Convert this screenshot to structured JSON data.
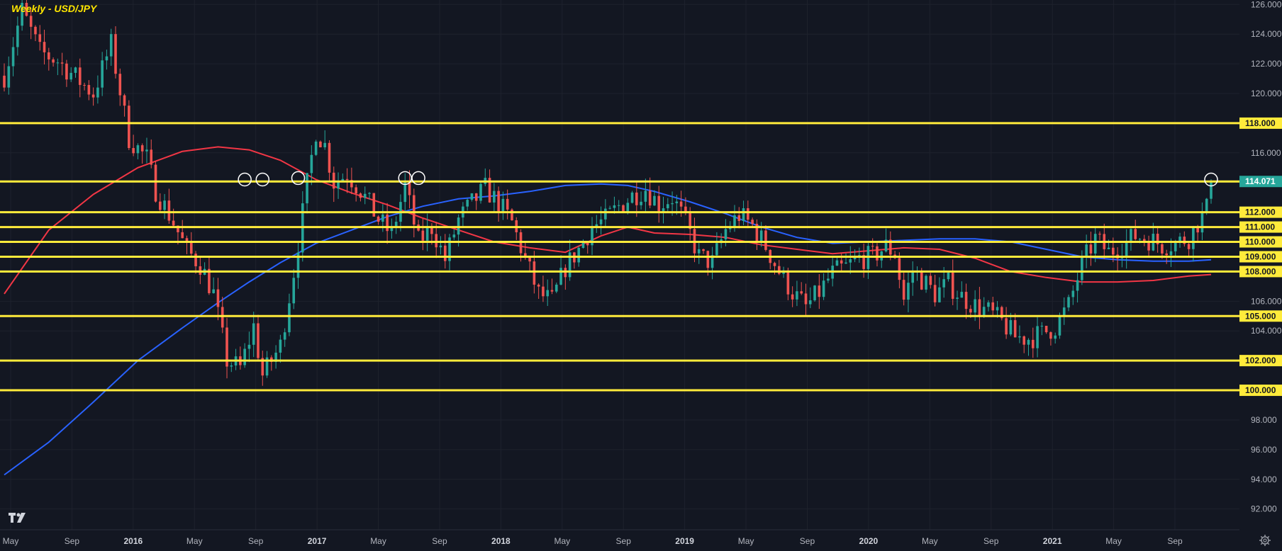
{
  "chart_data": {
    "type": "candlestick",
    "title": "Weekly - USD/JPY",
    "ylim": [
      90.6,
      126.3
    ],
    "y_ticks": [
      "126.000",
      "124.000",
      "122.000",
      "120.000",
      "118.000",
      "116.000",
      "114.000",
      "112.000",
      "110.000",
      "108.000",
      "106.000",
      "104.000",
      "102.000",
      "100.000",
      "98.000",
      "96.000",
      "94.000",
      "92.000"
    ],
    "x_labels": [
      {
        "label": "May",
        "bold": false
      },
      {
        "label": "Sep",
        "bold": false
      },
      {
        "label": "2016",
        "bold": true
      },
      {
        "label": "May",
        "bold": false
      },
      {
        "label": "Sep",
        "bold": false
      },
      {
        "label": "2017",
        "bold": true
      },
      {
        "label": "May",
        "bold": false
      },
      {
        "label": "Sep",
        "bold": false
      },
      {
        "label": "2018",
        "bold": true
      },
      {
        "label": "May",
        "bold": false
      },
      {
        "label": "Sep",
        "bold": false
      },
      {
        "label": "2019",
        "bold": true
      },
      {
        "label": "May",
        "bold": false
      },
      {
        "label": "Sep",
        "bold": false
      },
      {
        "label": "2020",
        "bold": true
      },
      {
        "label": "May",
        "bold": false
      },
      {
        "label": "Sep",
        "bold": false
      },
      {
        "label": "2021",
        "bold": true
      },
      {
        "label": "May",
        "bold": false
      },
      {
        "label": "Sep",
        "bold": false
      }
    ],
    "horizontal_levels": [
      {
        "value": 118.0,
        "label": "118.000"
      },
      {
        "value": 114.071,
        "label": "114.071"
      },
      {
        "value": 112.0,
        "label": "112.000"
      },
      {
        "value": 111.0,
        "label": "111.000"
      },
      {
        "value": 110.0,
        "label": "110.000"
      },
      {
        "value": 109.0,
        "label": "109.000"
      },
      {
        "value": 108.0,
        "label": "108.000"
      },
      {
        "value": 105.0,
        "label": "105.000"
      },
      {
        "value": 102.0,
        "label": "102.000"
      },
      {
        "value": 100.0,
        "label": "100.000"
      }
    ],
    "last_price": {
      "value": 114.071,
      "label": "114.071"
    },
    "price_path": [
      [
        0,
        121.2
      ],
      [
        4,
        125.6
      ],
      [
        8,
        122.8
      ],
      [
        12,
        122.2
      ],
      [
        16,
        121.1
      ],
      [
        20,
        120.0
      ],
      [
        24,
        123.3
      ],
      [
        28,
        117.0
      ],
      [
        32,
        115.6
      ],
      [
        34,
        113.5
      ],
      [
        38,
        111.3
      ],
      [
        41,
        109.4
      ],
      [
        44,
        108.5
      ],
      [
        47,
        106.5
      ],
      [
        50,
        102.0
      ],
      [
        53,
        101.5
      ],
      [
        56,
        104.3
      ],
      [
        58,
        101.0
      ],
      [
        62,
        103.0
      ],
      [
        65,
        108.0
      ],
      [
        68,
        113.9
      ],
      [
        70,
        117.5
      ],
      [
        72,
        116.5
      ],
      [
        74,
        114.0
      ],
      [
        77,
        114.6
      ],
      [
        80,
        113.5
      ],
      [
        84,
        111.5
      ],
      [
        87,
        110.5
      ],
      [
        90,
        113.8
      ],
      [
        93,
        110.0
      ],
      [
        96,
        111.0
      ],
      [
        99,
        108.8
      ],
      [
        102,
        111.5
      ],
      [
        105,
        112.6
      ],
      [
        108,
        113.6
      ],
      [
        111,
        112.6
      ],
      [
        114,
        111.3
      ],
      [
        117,
        108.8
      ],
      [
        120,
        106.5
      ],
      [
        123,
        106.0
      ],
      [
        126,
        108.3
      ],
      [
        129,
        109.5
      ],
      [
        132,
        111.0
      ],
      [
        135,
        111.5
      ],
      [
        138,
        112.4
      ],
      [
        141,
        113.1
      ],
      [
        144,
        113.6
      ],
      [
        147,
        112.5
      ],
      [
        150,
        113.0
      ],
      [
        153,
        111.3
      ],
      [
        156,
        109.0
      ],
      [
        159,
        108.6
      ],
      [
        162,
        110.8
      ],
      [
        165,
        111.8
      ],
      [
        168,
        111.1
      ],
      [
        171,
        109.7
      ],
      [
        174,
        108.0
      ],
      [
        177,
        106.6
      ],
      [
        180,
        105.6
      ],
      [
        183,
        106.6
      ],
      [
        186,
        107.9
      ],
      [
        189,
        108.3
      ],
      [
        192,
        108.9
      ],
      [
        195,
        109.0
      ],
      [
        198,
        109.7
      ],
      [
        200,
        109.2
      ],
      [
        202,
        106.1
      ],
      [
        204,
        108.0
      ],
      [
        206,
        107.5
      ],
      [
        209,
        106.5
      ],
      [
        212,
        107.2
      ],
      [
        215,
        106.3
      ],
      [
        218,
        105.7
      ],
      [
        221,
        105.3
      ],
      [
        224,
        104.6
      ],
      [
        227,
        103.6
      ],
      [
        230,
        103.5
      ],
      [
        233,
        103.8
      ],
      [
        236,
        104.3
      ],
      [
        239,
        105.7
      ],
      [
        242,
        108.5
      ],
      [
        245,
        110.2
      ],
      [
        248,
        109.3
      ],
      [
        251,
        109.8
      ],
      [
        254,
        110.4
      ],
      [
        257,
        110.2
      ],
      [
        260,
        109.8
      ],
      [
        263,
        109.9
      ],
      [
        266,
        110.3
      ],
      [
        268,
        111.3
      ],
      [
        270,
        112.2
      ],
      [
        271,
        114.071
      ]
    ],
    "sma_red": [
      [
        0,
        106.5
      ],
      [
        10,
        110.8
      ],
      [
        20,
        113.2
      ],
      [
        30,
        115.0
      ],
      [
        40,
        116.1
      ],
      [
        48,
        116.4
      ],
      [
        55,
        116.2
      ],
      [
        62,
        115.5
      ],
      [
        70,
        114.2
      ],
      [
        78,
        113.3
      ],
      [
        86,
        112.5
      ],
      [
        94,
        111.6
      ],
      [
        102,
        110.8
      ],
      [
        110,
        110.0
      ],
      [
        118,
        109.6
      ],
      [
        126,
        109.3
      ],
      [
        134,
        110.4
      ],
      [
        140,
        111.0
      ],
      [
        146,
        110.6
      ],
      [
        154,
        110.5
      ],
      [
        162,
        110.3
      ],
      [
        170,
        109.8
      ],
      [
        178,
        109.5
      ],
      [
        186,
        109.2
      ],
      [
        194,
        109.4
      ],
      [
        202,
        109.6
      ],
      [
        210,
        109.5
      ],
      [
        218,
        108.9
      ],
      [
        226,
        108.0
      ],
      [
        234,
        107.6
      ],
      [
        242,
        107.3
      ],
      [
        250,
        107.3
      ],
      [
        258,
        107.4
      ],
      [
        266,
        107.7
      ],
      [
        271,
        107.8
      ]
    ],
    "sma_blue": [
      [
        0,
        94.3
      ],
      [
        10,
        96.5
      ],
      [
        20,
        99.2
      ],
      [
        30,
        102.0
      ],
      [
        40,
        104.2
      ],
      [
        48,
        105.9
      ],
      [
        55,
        107.3
      ],
      [
        62,
        108.6
      ],
      [
        70,
        109.9
      ],
      [
        78,
        110.8
      ],
      [
        86,
        111.7
      ],
      [
        94,
        112.4
      ],
      [
        102,
        112.9
      ],
      [
        110,
        113.1
      ],
      [
        118,
        113.4
      ],
      [
        126,
        113.8
      ],
      [
        134,
        113.9
      ],
      [
        140,
        113.8
      ],
      [
        146,
        113.4
      ],
      [
        154,
        112.7
      ],
      [
        162,
        111.9
      ],
      [
        170,
        111.0
      ],
      [
        178,
        110.3
      ],
      [
        186,
        109.9
      ],
      [
        194,
        110.0
      ],
      [
        202,
        110.1
      ],
      [
        210,
        110.2
      ],
      [
        218,
        110.2
      ],
      [
        226,
        110.0
      ],
      [
        234,
        109.5
      ],
      [
        242,
        109.0
      ],
      [
        250,
        108.8
      ],
      [
        258,
        108.7
      ],
      [
        266,
        108.7
      ],
      [
        271,
        108.8
      ]
    ],
    "circle_markers": [
      [
        54,
        114.2
      ],
      [
        58,
        114.2
      ],
      [
        66,
        114.3
      ],
      [
        90,
        114.3
      ],
      [
        93,
        114.3
      ],
      [
        271,
        114.2
      ]
    ]
  }
}
